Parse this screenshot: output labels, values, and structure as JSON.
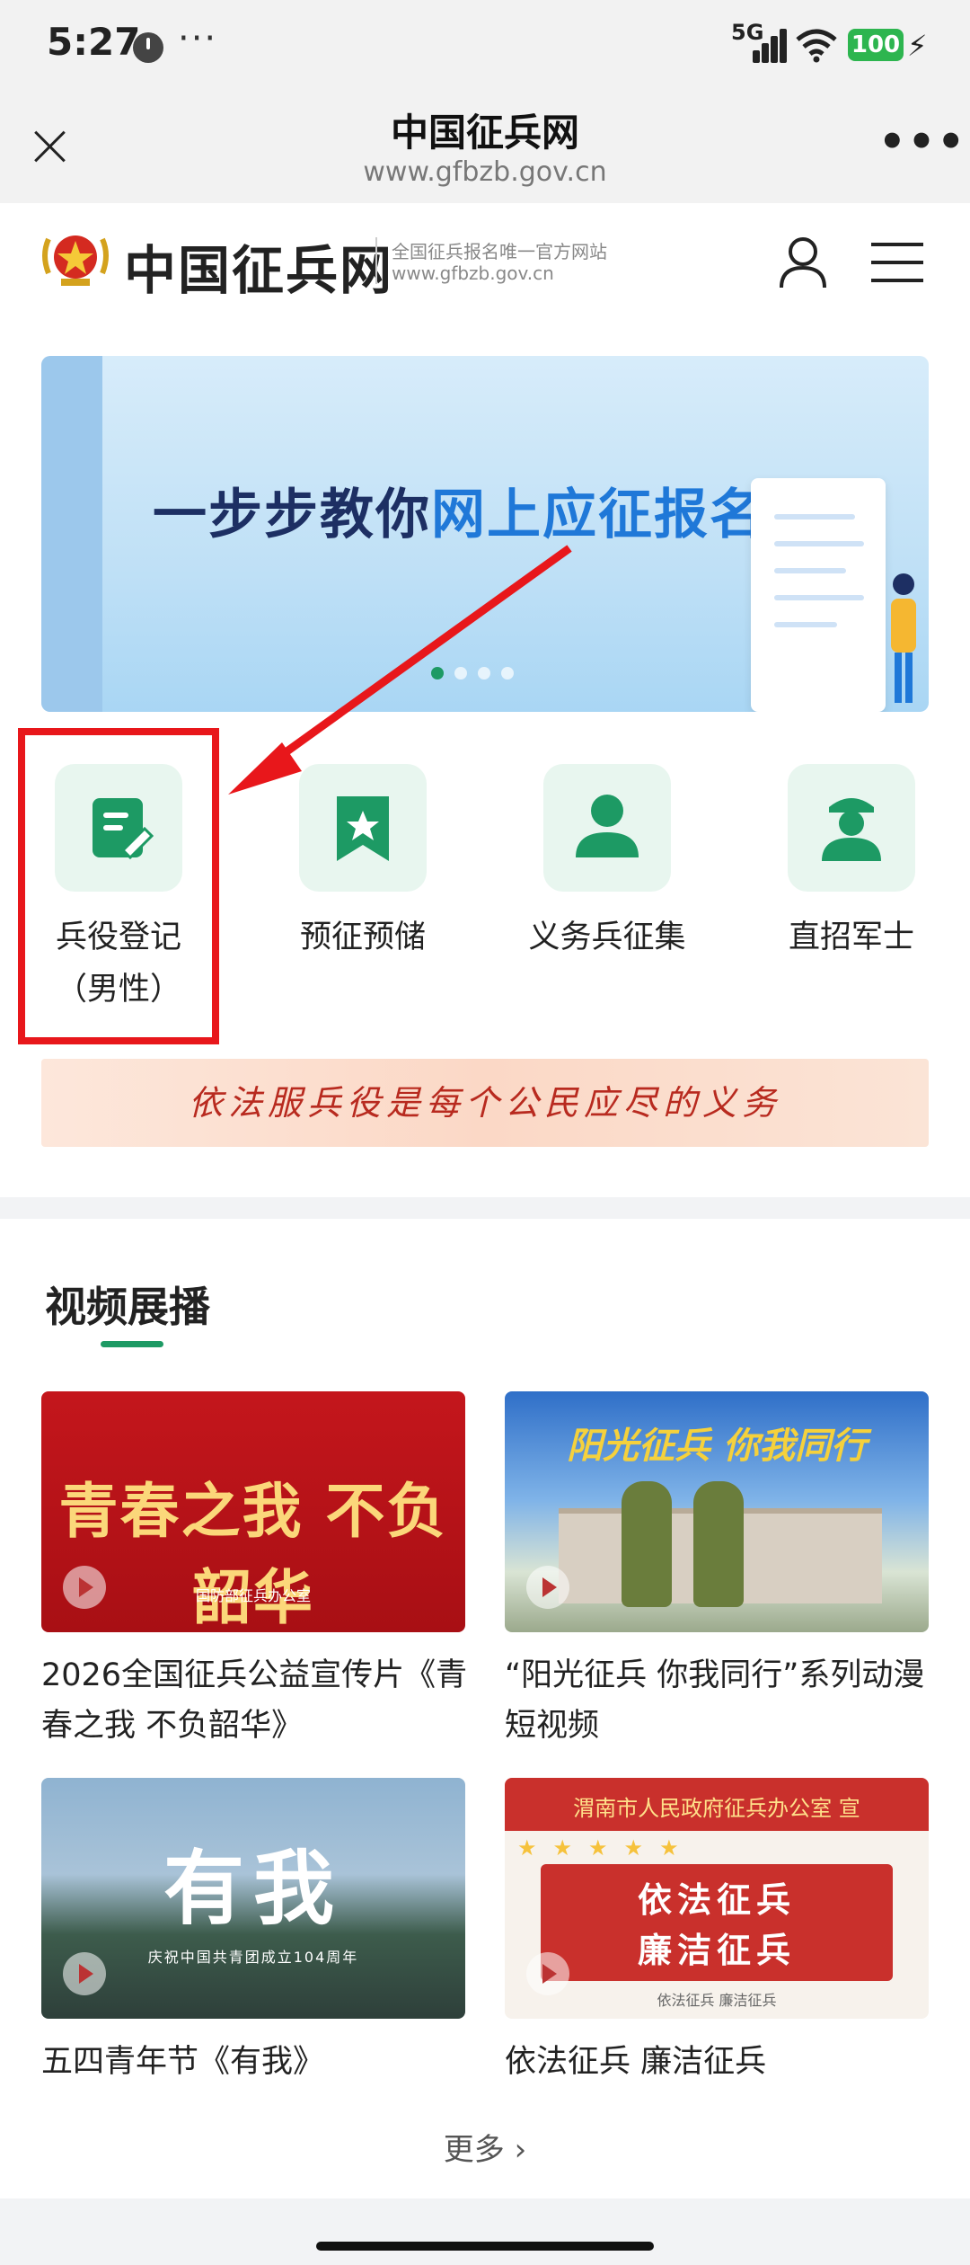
{
  "status_bar": {
    "time": "5:27",
    "more": "···",
    "network": "5G",
    "battery": "100"
  },
  "title_bar": {
    "title": "中国征兵网",
    "url": "www.gfbzb.gov.cn",
    "more": "•••"
  },
  "site_header": {
    "name": "中国征兵网",
    "tagline": "全国征兵报名唯一官方网站",
    "url": "www.gfbzb.gov.cn"
  },
  "banner": {
    "text_before": "一步步教你",
    "text_highlight": "网上应征报名",
    "active_dot": 0
  },
  "quick_entries": [
    {
      "label_line1": "兵役登记",
      "label_line2": "（男性）",
      "icon": "register-doc-icon"
    },
    {
      "label_line1": "预征预储",
      "label_line2": "",
      "icon": "bookmark-star-icon"
    },
    {
      "label_line1": "义务兵征集",
      "label_line2": "",
      "icon": "person-icon"
    },
    {
      "label_line1": "直招军士",
      "label_line2": "",
      "icon": "soldier-icon"
    }
  ],
  "slogan": "依法服兵役是每个公民应尽的义务",
  "video_section": {
    "title": "视频展播",
    "videos": [
      {
        "title": "2026全国征兵公益宣传片《青春之我 不负韶华》",
        "thumb_text": "青春之我 不负韶华",
        "thumb_sub": "国防部征兵办公室"
      },
      {
        "title": "“阳光征兵 你我同行”系列动漫短视频",
        "thumb_text": "阳光征兵 你我同行"
      },
      {
        "title": "五四青年节《有我》",
        "thumb_text": "有我",
        "thumb_sub": "庆祝中国共青团成立104周年"
      },
      {
        "title": "依法征兵 廉洁征兵",
        "thumb_top": "渭南市人民政府征兵办公室 宣",
        "thumb_line1": "依法征兵",
        "thumb_line2": "廉洁征兵",
        "thumb_sub": "依法征兵 廉洁征兵"
      }
    ],
    "more": "更多 ›"
  },
  "colors": {
    "accent_green": "#1d9a64",
    "highlight_red": "#e8171b",
    "icon_bg": "#e8f6ef"
  }
}
